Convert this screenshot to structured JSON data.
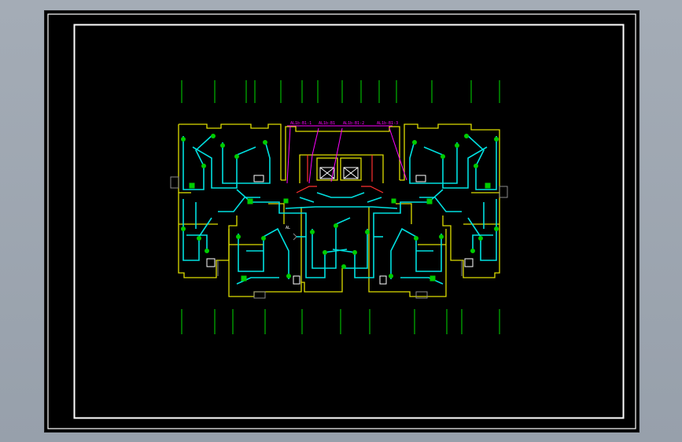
{
  "colors": {
    "background_outer": "#9aa3ad",
    "paper": "#000000",
    "frame": "#ffffff",
    "axis_lines": "#00dd00",
    "walls": "#dddd00",
    "wiring": "#00e0e0",
    "devices": "#00cc00",
    "labels_magenta": "#ff00ff",
    "stair_lines": "#ff3030",
    "gray_detail": "#9a9a9a"
  },
  "annotations": {
    "label_1": "AL1b-B1-1",
    "label_2": "AL1b-B1",
    "label_3": "AL1b-B1-2",
    "label_4": "AL1b-B1-3",
    "panel_tag": "AL"
  }
}
